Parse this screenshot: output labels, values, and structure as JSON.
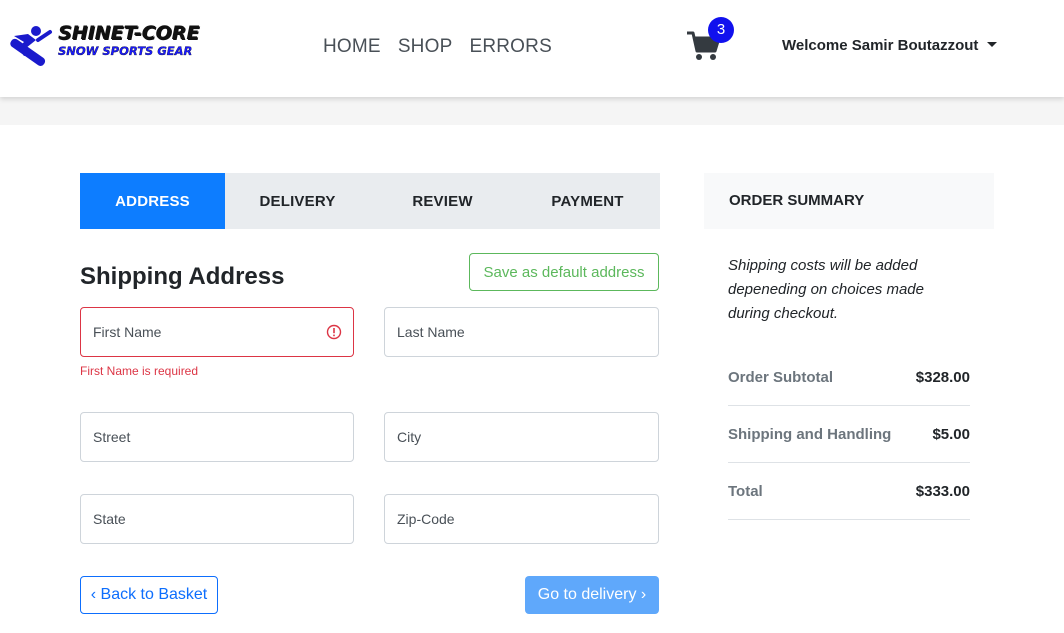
{
  "brand": {
    "name_line1": "SHINET-CORE",
    "name_line2": "SNOW SPORTS GEAR",
    "logo_icon": "snowboarder-icon"
  },
  "nav": {
    "links": [
      "HOME",
      "SHOP",
      "ERRORS"
    ],
    "cart_count": "3",
    "user_greeting": "Welcome Samir Boutazzout"
  },
  "steps": [
    {
      "label": "ADDRESS",
      "active": true
    },
    {
      "label": "DELIVERY",
      "active": false
    },
    {
      "label": "REVIEW",
      "active": false
    },
    {
      "label": "PAYMENT",
      "active": false
    }
  ],
  "address_form": {
    "title": "Shipping Address",
    "save_default_label": "Save as default address",
    "first_name_placeholder": "First Name",
    "last_name_placeholder": "Last Name",
    "street_placeholder": "Street",
    "city_placeholder": "City",
    "state_placeholder": "State",
    "zip_placeholder": "Zip-Code",
    "first_name_error": "First Name is required",
    "back_label": "Back to Basket",
    "next_label": "Go to delivery"
  },
  "summary": {
    "title": "ORDER SUMMARY",
    "note": "Shipping costs will be added depeneding on choices made during checkout.",
    "rows": [
      {
        "label": "Order Subtotal",
        "value": "$328.00"
      },
      {
        "label": "Shipping and Handling",
        "value": "$5.00"
      },
      {
        "label": "Total",
        "value": "$333.00"
      }
    ]
  },
  "colors": {
    "accent": "#0d7dff",
    "success": "#5cb85c",
    "danger": "#dc3545",
    "badge": "#1111ee"
  }
}
